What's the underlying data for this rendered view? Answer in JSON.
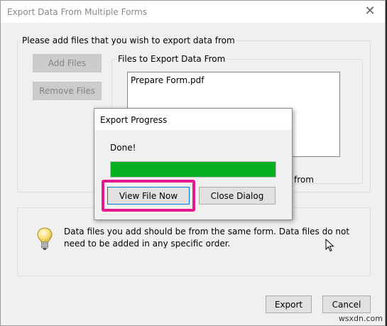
{
  "window": {
    "title": "Export Data From Multiple Forms",
    "close_glyph": "✕"
  },
  "files_group": {
    "legend": "Please add files that you wish to export data from",
    "add_files_label": "Add Files",
    "remove_files_label": "Remove Files",
    "list_legend": "Files to Export Data From",
    "files": [
      "Prepare Form.pdf"
    ],
    "partial_text": "from"
  },
  "info": {
    "icon": "lightbulb-icon",
    "line1": "Data files you add should be from the same form. Data files do not",
    "line2": "need to be added in any specific order."
  },
  "footer": {
    "export_label": "Export",
    "cancel_label": "Cancel"
  },
  "progress_dialog": {
    "title": "Export Progress",
    "status": "Done!",
    "progress_percent": 100,
    "view_file_label": "View File Now",
    "close_dialog_label": "Close Dialog"
  },
  "colors": {
    "progress": "#06b025",
    "highlight": "#e5198f"
  },
  "watermark": "wsxdn.com"
}
